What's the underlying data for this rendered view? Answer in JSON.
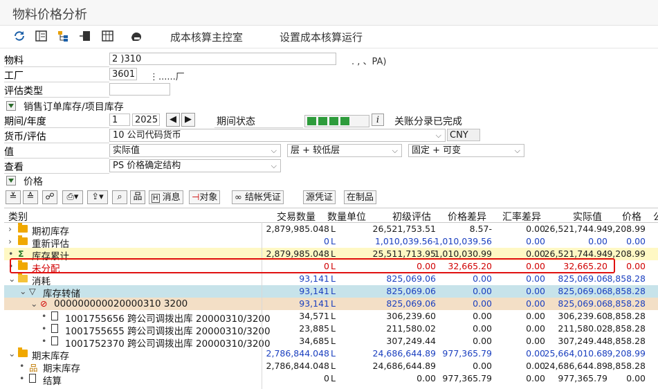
{
  "window": {
    "title": "物料价格分析"
  },
  "toolbar": {
    "icons": [
      "refresh-icon",
      "list-icon",
      "hierarchy-icon",
      "export-icon",
      "table-icon",
      "hand-icon"
    ],
    "cockpit_label": "成本核算主控室",
    "setup_label": "设置成本核算运行"
  },
  "header": {
    "material_label": "物料",
    "material_value": "2    )310",
    "material_desc": ".           ,              、PA)",
    "plant_label": "工厂",
    "plant_value": "3601",
    "plant_desc": "⋮......厂",
    "valuation_type_label": "评估类型",
    "valuation_type_value": "",
    "sales_order_stock_label": "销售订单库存/项目库存",
    "period_label": "期间/年度",
    "period_value": "1",
    "year_value": "2025",
    "period_status_label": "期间状态",
    "period_status_text": "关账分录已完成",
    "currency_label": "货币/评估",
    "currency_select": "10 公司代码货币",
    "currency_code": "CNY",
    "value_label": "值",
    "value_select": "实际值",
    "level_select": "层 + 较低层",
    "fixed_select": "固定 + 可变",
    "view_label": "查看",
    "view_select": "PS 价格确定结构",
    "price_section_label": "价格"
  },
  "grid_toolbar": {
    "message_label": "消息",
    "object_label": "对象",
    "settlement_doc_label": "结帐凭证",
    "source_doc_label": "源凭证",
    "wip_label": "在制品"
  },
  "grid": {
    "columns": [
      "类别",
      "交易数量",
      "数量单位",
      "初级评估",
      "价格差异",
      "汇率差异",
      "实际值",
      "价格",
      "公"
    ],
    "rows": [
      {
        "cat": "期初库存",
        "qty": "2,879,985.048",
        "unit": "L",
        "prim": "26,521,753.51",
        "pdiff": "8.57-",
        "fx": "0.00",
        "actual": "26,521,744.94",
        "price": "9,208.99",
        "style": "normal",
        "indent": 0,
        "icon": "folder",
        "expander": "›"
      },
      {
        "cat": "重新评估",
        "qty": "0",
        "unit": "L",
        "prim": "1,010,039.56-",
        "pdiff": "1,010,039.56",
        "fx": "0.00",
        "actual": "0.00",
        "price": "0.00",
        "style": "blue",
        "indent": 0,
        "icon": "folder",
        "expander": "›"
      },
      {
        "cat": "库存累计",
        "qty": "2,879,985.048",
        "unit": "L",
        "prim": "25,511,713.95",
        "pdiff": "1,010,030.99",
        "fx": "0.00",
        "actual": "26,521,744.94",
        "price": "9,208.99",
        "style": "yellow",
        "indent": 0,
        "icon": "sigma",
        "expander": "•"
      },
      {
        "cat": "未分配",
        "qty": "0",
        "unit": "L",
        "prim": "0.00",
        "pdiff": "32,665.20",
        "fx": "0.00",
        "actual": "32,665.20",
        "price": "0.00",
        "style": "red",
        "indent": 0,
        "icon": "folder",
        "expander": "•"
      },
      {
        "cat": "消耗",
        "qty": "93,141",
        "unit": "L",
        "prim": "825,069.06",
        "pdiff": "0.00",
        "fx": "0.00",
        "actual": "825,069.06",
        "price": "8,858.28",
        "style": "blue",
        "indent": 0,
        "icon": "folder-open",
        "expander": "⌄"
      },
      {
        "cat": "库存转储",
        "qty": "93,141",
        "unit": "L",
        "prim": "825,069.06",
        "pdiff": "0.00",
        "fx": "0.00",
        "actual": "825,069.06",
        "price": "8,858.28",
        "style": "teal",
        "indent": 1,
        "icon": "funnel",
        "expander": "⌄"
      },
      {
        "cat": "000000000020000310 3200",
        "qty": "93,141",
        "unit": "L",
        "prim": "825,069.06",
        "pdiff": "0.00",
        "fx": "0.00",
        "actual": "825,069.06",
        "price": "8,858.28",
        "style": "tan",
        "indent": 2,
        "icon": "stop",
        "expander": "⌄"
      },
      {
        "cat": "1001755656 跨公司调拨出库 20000310/3200",
        "qty": "34,571",
        "unit": "L",
        "prim": "306,239.60",
        "pdiff": "0.00",
        "fx": "0.00",
        "actual": "306,239.60",
        "price": "8,858.28",
        "style": "normal",
        "indent": 3,
        "icon": "doc",
        "expander": "•"
      },
      {
        "cat": "1001755655 跨公司调拨出库 20000310/3200",
        "qty": "23,885",
        "unit": "L",
        "prim": "211,580.02",
        "pdiff": "0.00",
        "fx": "0.00",
        "actual": "211,580.02",
        "price": "8,858.28",
        "style": "normal",
        "indent": 3,
        "icon": "doc",
        "expander": "•"
      },
      {
        "cat": "1001752370 跨公司调拨出库 20000310/3200",
        "qty": "34,685",
        "unit": "L",
        "prim": "307,249.44",
        "pdiff": "0.00",
        "fx": "0.00",
        "actual": "307,249.44",
        "price": "8,858.28",
        "style": "normal",
        "indent": 3,
        "icon": "doc",
        "expander": "•"
      },
      {
        "cat": "期末库存",
        "qty": "2,786,844.048",
        "unit": "L",
        "prim": "24,686,644.89",
        "pdiff": "977,365.79",
        "fx": "0.00",
        "actual": "25,664,010.68",
        "price": "9,208.99",
        "style": "blue",
        "indent": 0,
        "icon": "folder",
        "expander": "⌄"
      },
      {
        "cat": "期末库存",
        "qty": "2,786,844.048",
        "unit": "L",
        "prim": "24,686,644.89",
        "pdiff": "0.00",
        "fx": "0.00",
        "actual": "24,686,644.89",
        "price": "8,858.28",
        "style": "normal",
        "indent": 1,
        "icon": "org",
        "expander": "•"
      },
      {
        "cat": "结算",
        "qty": "0",
        "unit": "L",
        "prim": "0.00",
        "pdiff": "977,365.79",
        "fx": "0.00",
        "actual": "977,365.79",
        "price": "0.00",
        "style": "normal",
        "indent": 1,
        "icon": "doc",
        "expander": "•"
      }
    ]
  },
  "colors": {
    "blue_text": "#1a3fbf",
    "red_text": "#d00000",
    "yellow_row": "#fff8c4",
    "teal_row": "#c7e3ea",
    "tan_row": "#f3dfc6",
    "red_box": "#e01010",
    "status_green": "#2e9c3c"
  }
}
